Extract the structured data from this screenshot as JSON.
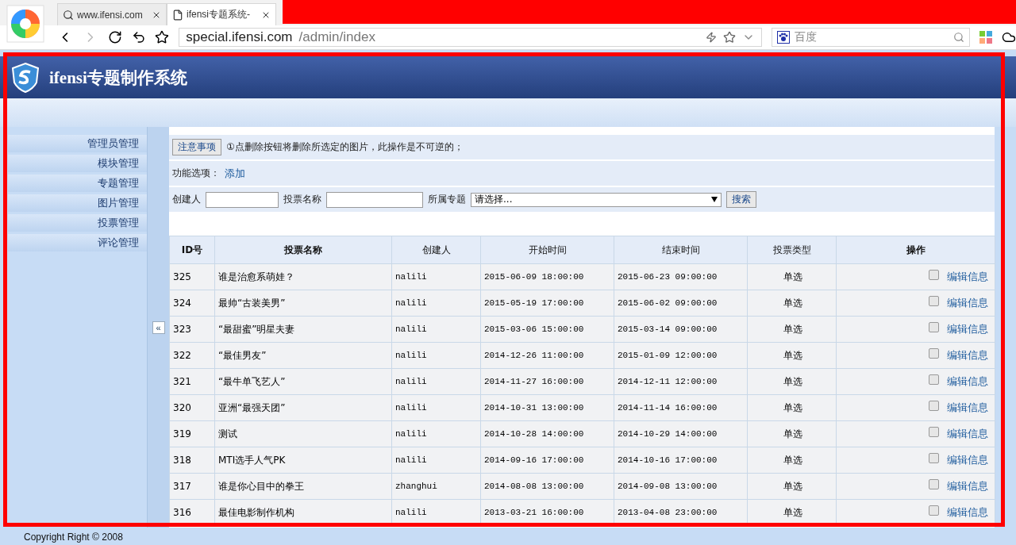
{
  "browser": {
    "tabs": [
      {
        "title": "www.ifensi.com",
        "selected": false
      },
      {
        "title": "ifensi专题系统-",
        "selected": true
      }
    ],
    "address": {
      "host": "special.ifensi.com",
      "path": "/admin/index"
    },
    "search": {
      "placeholder": "百度"
    }
  },
  "header": {
    "title": "ifensi专题制作系统"
  },
  "sidebar": {
    "items": [
      {
        "label": "管理员管理"
      },
      {
        "label": "模块管理"
      },
      {
        "label": "专题管理"
      },
      {
        "label": "图片管理"
      },
      {
        "label": "投票管理"
      },
      {
        "label": "评论管理"
      }
    ],
    "collapse": "«"
  },
  "notice": {
    "button": "注意事项",
    "text": "①点删除按钮将删除所选定的图片，此操作是不可逆的；"
  },
  "options": {
    "label": "功能选项：",
    "link": "添加"
  },
  "filters": {
    "fields": [
      {
        "label": "创建人"
      },
      {
        "label": "投票名称"
      }
    ],
    "select": {
      "label": "所属专题",
      "value": "请选择..."
    },
    "button": "搜索"
  },
  "table": {
    "columns": [
      "ID号",
      "投票名称",
      "创建人",
      "开始时间",
      "结束时间",
      "投票类型",
      "操作"
    ],
    "rows": [
      {
        "id": "325",
        "name": "谁是治愈系萌娃？",
        "creator": "nalili",
        "start": "2015-06-09 18:00:00",
        "end": "2015-06-23 09:00:00",
        "type": "单选",
        "checked": false,
        "action": "编辑信息"
      },
      {
        "id": "324",
        "name": "最帅“古装美男”",
        "creator": "nalili",
        "start": "2015-05-19 17:00:00",
        "end": "2015-06-02 09:00:00",
        "type": "单选",
        "checked": false,
        "action": "编辑信息"
      },
      {
        "id": "323",
        "name": "“最甜蜜”明星夫妻",
        "creator": "nalili",
        "start": "2015-03-06 15:00:00",
        "end": "2015-03-14 09:00:00",
        "type": "单选",
        "checked": false,
        "action": "编辑信息"
      },
      {
        "id": "322",
        "name": "“最佳男友”",
        "creator": "nalili",
        "start": "2014-12-26 11:00:00",
        "end": "2015-01-09 12:00:00",
        "type": "单选",
        "checked": false,
        "action": "编辑信息"
      },
      {
        "id": "321",
        "name": "“最牛单飞艺人”",
        "creator": "nalili",
        "start": "2014-11-27 16:00:00",
        "end": "2014-12-11 12:00:00",
        "type": "单选",
        "checked": false,
        "action": "编辑信息"
      },
      {
        "id": "320",
        "name": "亚洲“最强天团”",
        "creator": "nalili",
        "start": "2014-10-31 13:00:00",
        "end": "2014-11-14 16:00:00",
        "type": "单选",
        "checked": false,
        "action": "编辑信息"
      },
      {
        "id": "319",
        "name": "测试",
        "creator": "nalili",
        "start": "2014-10-28 14:00:00",
        "end": "2014-10-29 14:00:00",
        "type": "单选",
        "checked": false,
        "action": "编辑信息"
      },
      {
        "id": "318",
        "name": "MTI选手人气PK",
        "creator": "nalili",
        "start": "2014-09-16 17:00:00",
        "end": "2014-10-16 17:00:00",
        "type": "单选",
        "checked": false,
        "action": "编辑信息"
      },
      {
        "id": "317",
        "name": "谁是你心目中的拳王",
        "creator": "zhanghui",
        "start": "2014-08-08 13:00:00",
        "end": "2014-09-08 13:00:00",
        "type": "单选",
        "checked": false,
        "action": "编辑信息"
      },
      {
        "id": "316",
        "name": "最佳电影制作机构",
        "creator": "nalili",
        "start": "2013-03-21 16:00:00",
        "end": "2013-04-08 23:00:00",
        "type": "单选",
        "checked": false,
        "action": "编辑信息"
      }
    ]
  },
  "footer": {
    "text": "Copyright Right © 2008"
  }
}
